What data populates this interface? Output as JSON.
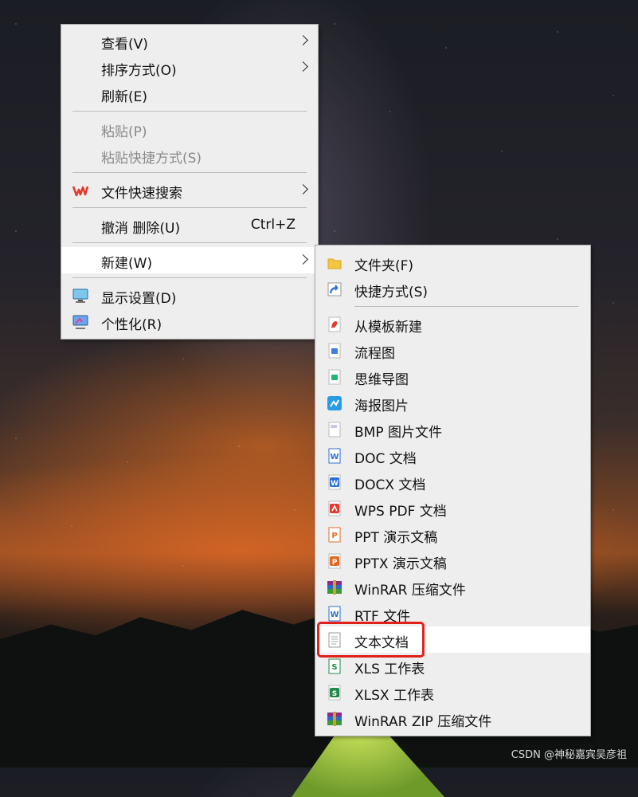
{
  "main_menu": {
    "items": [
      {
        "label": "查看(V)"
      },
      {
        "label": "排序方式(O)"
      },
      {
        "label": "刷新(E)"
      },
      {
        "label": "粘贴(P)"
      },
      {
        "label": "粘贴快捷方式(S)"
      },
      {
        "label": "文件快速搜索"
      },
      {
        "label": "撤消 删除(U)",
        "shortcut": "Ctrl+Z"
      },
      {
        "label": "新建(W)"
      },
      {
        "label": "显示设置(D)"
      },
      {
        "label": "个性化(R)"
      }
    ]
  },
  "submenu": {
    "items": [
      {
        "label": "文件夹(F)",
        "icon": "folder-icon"
      },
      {
        "label": "快捷方式(S)",
        "icon": "shortcut-icon"
      },
      {
        "label": "从模板新建",
        "icon": "template-icon"
      },
      {
        "label": "流程图",
        "icon": "flowchart-icon"
      },
      {
        "label": "思维导图",
        "icon": "mindmap-icon"
      },
      {
        "label": "海报图片",
        "icon": "poster-icon"
      },
      {
        "label": "BMP 图片文件",
        "icon": "bmp-file-icon"
      },
      {
        "label": "DOC 文档",
        "icon": "doc-file-icon"
      },
      {
        "label": "DOCX 文档",
        "icon": "docx-file-icon"
      },
      {
        "label": "WPS PDF 文档",
        "icon": "pdf-file-icon"
      },
      {
        "label": "PPT 演示文稿",
        "icon": "ppt-file-icon"
      },
      {
        "label": "PPTX 演示文稿",
        "icon": "pptx-file-icon"
      },
      {
        "label": "WinRAR 压缩文件",
        "icon": "winrar-icon"
      },
      {
        "label": "RTF 文件",
        "icon": "rtf-file-icon"
      },
      {
        "label": "文本文档",
        "icon": "text-file-icon"
      },
      {
        "label": "XLS 工作表",
        "icon": "xls-file-icon"
      },
      {
        "label": "XLSX 工作表",
        "icon": "xlsx-file-icon"
      },
      {
        "label": "WinRAR ZIP 压缩文件",
        "icon": "winrar-zip-icon"
      }
    ]
  },
  "watermark": "CSDN @神秘嘉宾吴彦祖",
  "colors": {
    "menu_bg": "#eeeeee",
    "hover_bg": "#ffffff",
    "highlight_border": "#e0201b",
    "wps_red": "#e33b2e",
    "word_blue": "#2b6fd6",
    "excel_green": "#1f8a4c",
    "ppt_orange": "#e46a24"
  }
}
